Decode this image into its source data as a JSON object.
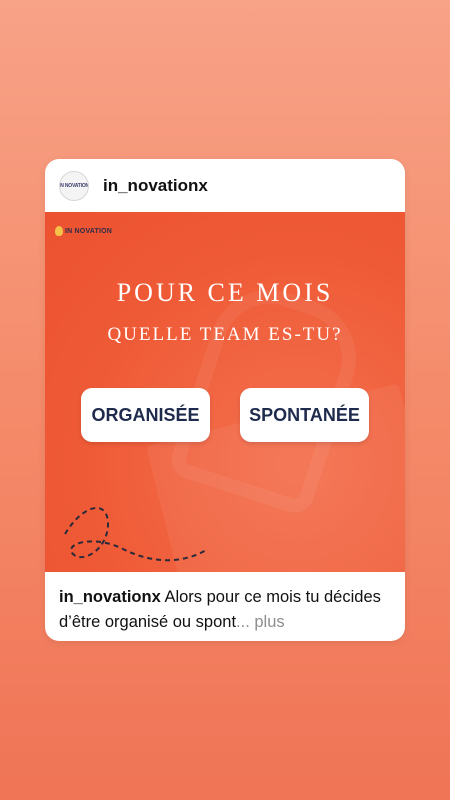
{
  "post": {
    "username": "in_novationx",
    "avatar_text": "IN NOVATION",
    "brand_logo_text": "IN NOVATION",
    "headline": "POUR CE MOIS",
    "subheadline": "QUELLE TEAM ES-TU?",
    "options": [
      "ORGANISÉE",
      "SPONTANÉE"
    ],
    "caption_user": "in_novationx",
    "caption_text": " Alors pour ce mois tu décides d’être organisé ou spont",
    "caption_more": "... plus"
  },
  "colors": {
    "background_top": "#f8a287",
    "background_bottom": "#f07456",
    "post_orange": "#ef5a36",
    "button_text": "#1f2b4d"
  }
}
